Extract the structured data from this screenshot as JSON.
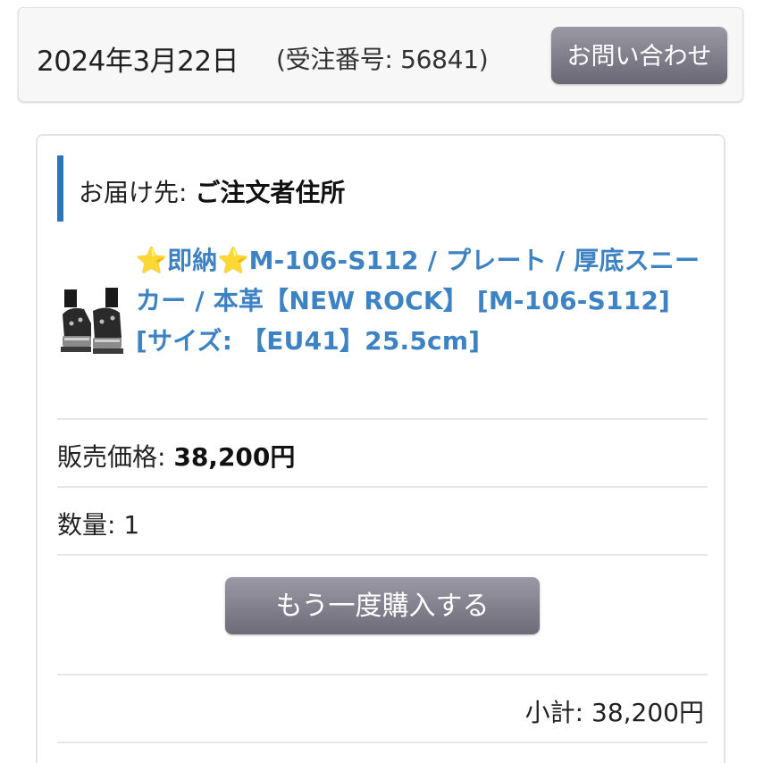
{
  "order": {
    "date": "2024年3月22日",
    "number_text": "(受注番号: 56841)",
    "contact_label": "お問い合わせ"
  },
  "shipment": {
    "destination_label": "お届け先: ",
    "destination_value": "ご注文者住所"
  },
  "product": {
    "star_icon": "⭐",
    "name_part1": "即納",
    "name_part2": "M-106-S112 / プレート / 厚底スニーカー / 本革【NEW ROCK】 [M-106-S112]",
    "size_text": "[サイズ: 【EU41】25.5cm]",
    "thumbnail_icon": "platform-sneaker-image"
  },
  "price": {
    "label": "販売価格: ",
    "value": "38,200円"
  },
  "quantity": {
    "label": "数量: ",
    "value": "1"
  },
  "reorder_label": "もう一度購入する",
  "subtotal": {
    "label": "小計: ",
    "value": "38,200円"
  },
  "colors": {
    "accent_blue": "#3d82c2",
    "bar_blue": "#2f74b8",
    "button_gray": "#7a7885"
  }
}
